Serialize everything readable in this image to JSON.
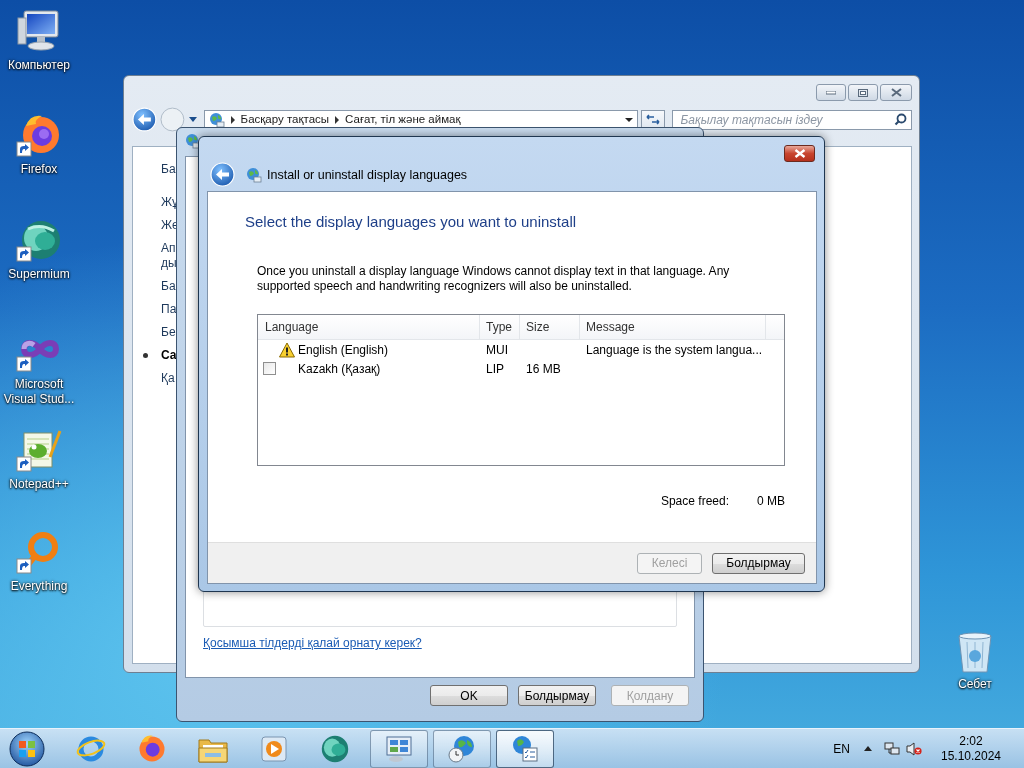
{
  "desktop_icons": [
    {
      "label": "Компьютер",
      "shortcut": false
    },
    {
      "label": "Firefox",
      "shortcut": true
    },
    {
      "label": "Supermium",
      "shortcut": true
    },
    {
      "label": "Microsoft Visual Stud...",
      "shortcut": true
    },
    {
      "label": "Notepad++",
      "shortcut": true
    },
    {
      "label": "Everything",
      "shortcut": true
    }
  ],
  "recycle_bin": {
    "label": "Себет"
  },
  "control_panel": {
    "breadcrumb": [
      "Басқару тақтасы",
      "Сағат, тіл және аймақ"
    ],
    "search": {
      "placeholder": "Бақылау тақтасын іздеу"
    },
    "sidebar": [
      {
        "lines": [
          "Ба"
        ],
        "selected": false
      },
      {
        "lines": [
          "Жұ"
        ],
        "selected": false
      },
      {
        "lines": [
          "Же"
        ],
        "selected": false
      },
      {
        "lines": [
          "Ап",
          "ды"
        ],
        "selected": false
      },
      {
        "lines": [
          "Ба"
        ],
        "selected": false
      },
      {
        "lines": [
          "Па"
        ],
        "selected": false
      },
      {
        "lines": [
          "Бе"
        ],
        "selected": false
      },
      {
        "lines": [
          "Са"
        ],
        "selected": true
      },
      {
        "lines": [
          "Қа"
        ],
        "selected": false
      }
    ]
  },
  "region_window": {
    "link": "Қосымша тілдерді қалай орнату керек?",
    "buttons": [
      {
        "label": "OK",
        "disabled": false
      },
      {
        "label": "Болдырмау",
        "disabled": false
      },
      {
        "label": "Қолдану",
        "disabled": true
      }
    ]
  },
  "dialog": {
    "title": "Install or uninstall display languages",
    "heading": "Select the display languages you want to uninstall",
    "description": "Once you uninstall a display language Windows cannot display text in that language. Any supported speech and handwriting recognizers will also be uninstalled.",
    "columns": [
      "Language",
      "Type",
      "Size",
      "Message"
    ],
    "rows": [
      {
        "kind": "warning",
        "language": "English (English)",
        "type": "MUI",
        "message": "Language is the system langua..."
      },
      {
        "kind": "checkbox",
        "checked": false,
        "language": "Kazakh (Қазақ)",
        "type": "LIP",
        "size": "16 MB"
      }
    ],
    "space_freed": {
      "label": "Space freed:",
      "value": "0 MB"
    },
    "buttons": [
      {
        "label": "Келесі",
        "disabled": true
      },
      {
        "label": "Болдырмау",
        "disabled": false
      }
    ]
  },
  "taskbar": {
    "tasks": [
      {
        "selected": false
      },
      {
        "selected": false
      },
      {
        "selected": true
      }
    ],
    "language": "EN",
    "time": "2:02",
    "date": "15.10.2024"
  }
}
